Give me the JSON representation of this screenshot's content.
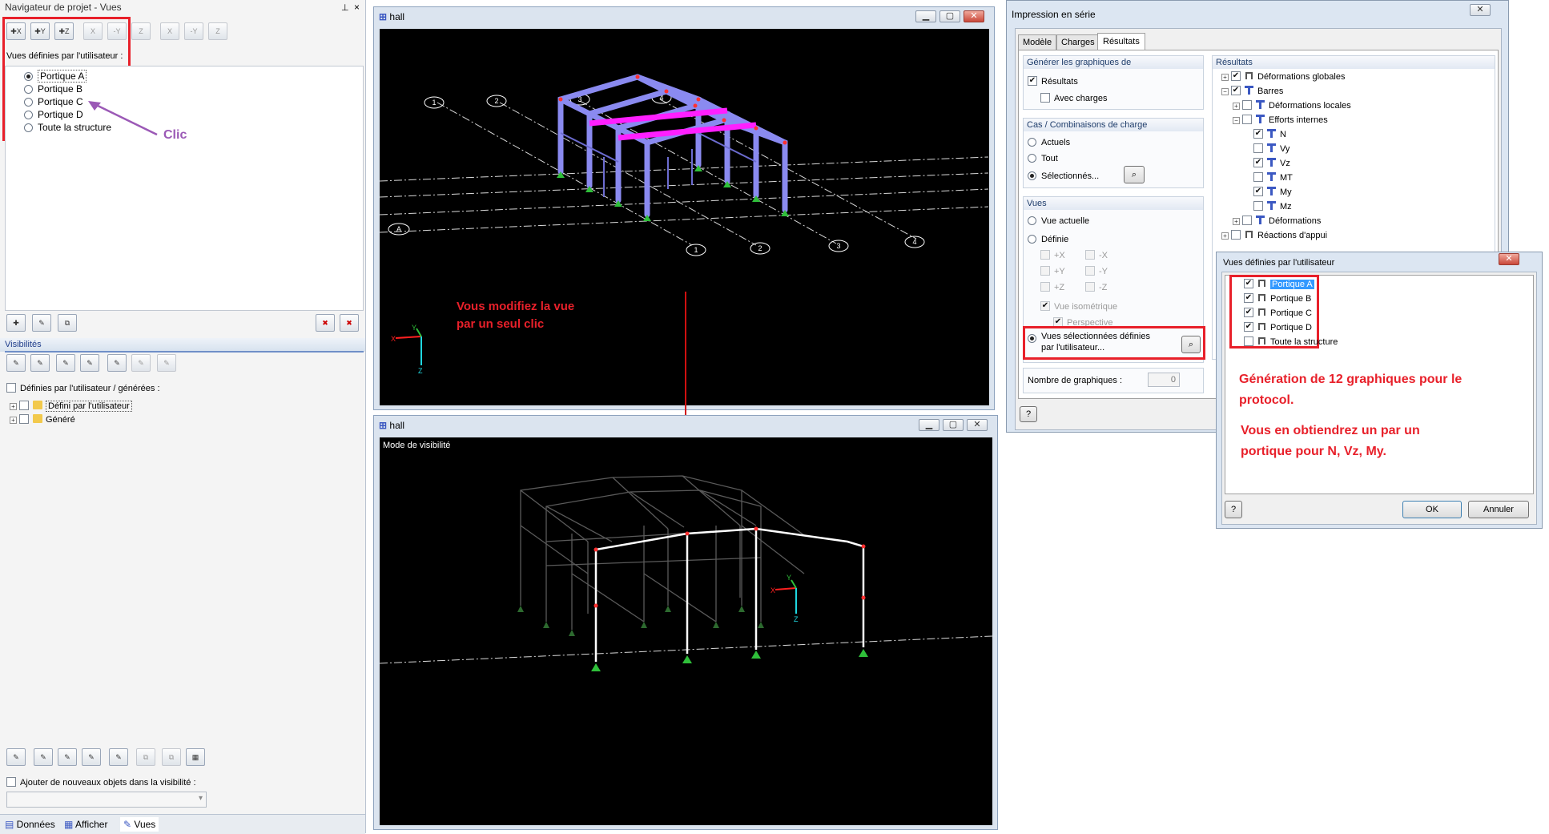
{
  "navigator": {
    "title": "Navigateur de projet - Vues",
    "pin_icon": "pin-icon",
    "close_icon": "close-icon",
    "toolbar_top": [
      "X",
      "Y",
      "Z",
      "X",
      "-Y",
      "Z",
      "X",
      "-Y",
      "Z",
      "?"
    ],
    "user_views_label": "Vues définies par l'utilisateur :",
    "views": [
      {
        "label": "Portique A",
        "selected": true
      },
      {
        "label": "Portique B",
        "selected": false
      },
      {
        "label": "Portique C",
        "selected": false
      },
      {
        "label": "Portique D",
        "selected": false
      },
      {
        "label": "Toute la structure",
        "selected": false
      }
    ],
    "click_annotation": "Clic",
    "visibilities_title": "Visibilités",
    "user_generated_label": "Définies par l'utilisateur / générées :",
    "tree": [
      {
        "label": "Défini par l'utilisateur"
      },
      {
        "label": "Généré"
      }
    ],
    "add_objects_label": "Ajouter de nouveaux objets dans la visibilité :",
    "bottom_tabs": [
      "Données",
      "Afficher",
      "Vues"
    ]
  },
  "window_top": {
    "title": "hall",
    "axis_labels": {
      "x": "X",
      "y": "Y",
      "z": "Z"
    },
    "grid_labels_top": [
      "1",
      "2",
      "3",
      "4"
    ],
    "grid_labels_bottom": [
      "1",
      "2",
      "3",
      "4"
    ],
    "grid_label_a": "A",
    "annotation_lines": [
      "Vous modifiez la vue",
      "par un seul clic"
    ]
  },
  "window_bottom": {
    "title": "hall",
    "mode_label": "Mode de visibilité",
    "axis_labels": {
      "x": "X",
      "y": "Y",
      "z": "Z"
    }
  },
  "print_dialog": {
    "title": "Impression en série",
    "tabs": [
      "Modèle",
      "Charges",
      "Résultats"
    ],
    "active_tab": "Résultats",
    "generate_group": "Générer les graphiques de",
    "results_label": "Résultats",
    "with_loads_label": "Avec charges",
    "cases_group": "Cas / Combinaisons de charge",
    "cases_options": [
      "Actuels",
      "Tout",
      "Sélectionnés..."
    ],
    "views_group": "Vues",
    "views_options": [
      "Vue actuelle",
      "Définie"
    ],
    "axis_options": [
      "+X",
      "-X",
      "+Y",
      "-Y",
      "+Z",
      "-Z"
    ],
    "isometric_label": "Vue isométrique",
    "perspective_label": "Perspective",
    "selected_user_views_label": "Vues sélectionnées définies par l'utilisateur...",
    "graphics_count_label": "Nombre de graphiques :",
    "graphics_count_value": "0",
    "results_tree_title": "Résultats",
    "results_tree": [
      {
        "label": "Déformations globales",
        "level": 0,
        "checked": true
      },
      {
        "label": "Barres",
        "level": 0,
        "checked": true
      },
      {
        "label": "Déformations locales",
        "level": 1,
        "checked": false
      },
      {
        "label": "Efforts internes",
        "level": 1,
        "checked": false
      },
      {
        "label": "N",
        "level": 2,
        "checked": true
      },
      {
        "label": "Vy",
        "level": 2,
        "checked": false
      },
      {
        "label": "Vz",
        "level": 2,
        "checked": true
      },
      {
        "label": "MT",
        "level": 2,
        "checked": false
      },
      {
        "label": "My",
        "level": 2,
        "checked": true
      },
      {
        "label": "Mz",
        "level": 2,
        "checked": false
      },
      {
        "label": "Déformations",
        "level": 1,
        "checked": false
      },
      {
        "label": "Réactions d'appui",
        "level": 0,
        "checked": false
      }
    ]
  },
  "user_views_dialog": {
    "title": "Vues définies par l'utilisateur",
    "items": [
      {
        "label": "Portique A",
        "checked": true
      },
      {
        "label": "Portique B",
        "checked": true
      },
      {
        "label": "Portique C",
        "checked": true
      },
      {
        "label": "Portique D",
        "checked": true
      },
      {
        "label": "Toute la structure",
        "checked": false
      }
    ],
    "annotation_1": [
      "Génération de 12 graphiques pour le",
      "protocol."
    ],
    "annotation_2": [
      "Vous en obtiendrez un par un",
      "portique pour N, Vz, My."
    ],
    "ok_label": "OK",
    "cancel_label": "Annuler"
  },
  "colors": {
    "accent_red": "#e8202a",
    "frame_blue": "#8a8af0",
    "beam_magenta": "#ff1fff",
    "annotation_purple": "#9b59b6"
  }
}
